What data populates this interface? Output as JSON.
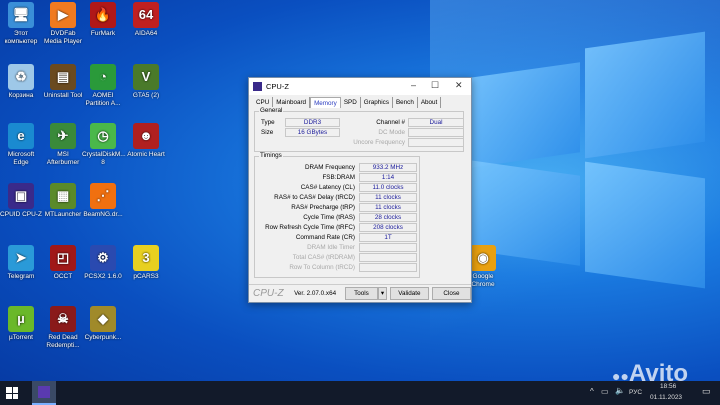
{
  "desktop_icons": [
    {
      "label": "Этот компьютер",
      "glyph": "🖥",
      "color": "#3a8fd8"
    },
    {
      "label": "DVDFab Media Player",
      "glyph": "▶",
      "color": "#f07a20"
    },
    {
      "label": "FurMark",
      "glyph": "🔥",
      "color": "#b01818"
    },
    {
      "label": "AIDA64",
      "glyph": "64",
      "color": "#c02020"
    },
    {
      "label": "Корзина",
      "glyph": "♻",
      "color": "#9ec8e8"
    },
    {
      "label": "Uninstall Tool",
      "glyph": "▤",
      "color": "#6a4a20"
    },
    {
      "label": "AOMEI Partition A...",
      "glyph": "◔",
      "color": "#2a9a3a"
    },
    {
      "label": "GTA5 (2)",
      "glyph": "V",
      "color": "#4a7a2a"
    },
    {
      "label": "Microsoft Edge",
      "glyph": "e",
      "color": "#1a8ad0"
    },
    {
      "label": "MSI Afterburner",
      "glyph": "✈",
      "color": "#3a8a3a"
    },
    {
      "label": "CrystalDiskM... 8",
      "glyph": "◷",
      "color": "#4ab84a"
    },
    {
      "label": "Atomic Heart",
      "glyph": "☻",
      "color": "#b02020"
    },
    {
      "label": "CPUID CPU-Z",
      "glyph": "▣",
      "color": "#3a2a8a"
    },
    {
      "label": "MTLauncher",
      "glyph": "▦",
      "color": "#5a8a2a"
    },
    {
      "label": "BeamNG.dr...",
      "glyph": "⋰",
      "color": "#f07010"
    },
    {
      "label": "Telegram",
      "glyph": "➤",
      "color": "#2a9ad8"
    },
    {
      "label": "OCCT",
      "glyph": "◰",
      "color": "#a01818"
    },
    {
      "label": "PCSX2 1.6.0",
      "glyph": "⚙",
      "color": "#2a4ab0"
    },
    {
      "label": "pCARS3",
      "glyph": "3",
      "color": "#e8d020"
    },
    {
      "label": "µTorrent",
      "glyph": "µ",
      "color": "#6ab82a"
    },
    {
      "label": "Red Dead Redempti...",
      "glyph": "☠",
      "color": "#8a1a1a"
    },
    {
      "label": "Cyberpunk...",
      "glyph": "◆",
      "color": "#a08a2a"
    },
    {
      "label": "Google Chrome",
      "glyph": "◉",
      "color": "#e8a010"
    }
  ],
  "cpuz": {
    "title": "CPU-Z",
    "tabs": [
      "CPU",
      "Mainboard",
      "Memory",
      "SPD",
      "Graphics",
      "Bench",
      "About"
    ],
    "general_label": "General",
    "type_label": "Type",
    "type": "DDR3",
    "size_label": "Size",
    "size": "16 GBytes",
    "channel_label": "Channel #",
    "channel": "Dual",
    "dc_mode_label": "DC Mode",
    "uncore_label": "Uncore Frequency",
    "timings_label": "Timings",
    "timings": [
      {
        "label": "DRAM Frequency",
        "value": "933.2 MHz"
      },
      {
        "label": "FSB:DRAM",
        "value": "1:14"
      },
      {
        "label": "CAS# Latency (CL)",
        "value": "11.0 clocks"
      },
      {
        "label": "RAS# to CAS# Delay (tRCD)",
        "value": "11 clocks"
      },
      {
        "label": "RAS# Precharge (tRP)",
        "value": "11 clocks"
      },
      {
        "label": "Cycle Time (tRAS)",
        "value": "28 clocks"
      },
      {
        "label": "Row Refresh Cycle Time (tRFC)",
        "value": "208 clocks"
      },
      {
        "label": "Command Rate (CR)",
        "value": "1T"
      },
      {
        "label": "DRAM Idle Timer",
        "value": ""
      },
      {
        "label": "Total CAS# (tRDRAM)",
        "value": ""
      },
      {
        "label": "Row To Column (tRCD)",
        "value": ""
      }
    ],
    "brand": "CPU-Z",
    "version": "Ver. 2.07.0.x64",
    "tools": "Tools",
    "validate": "Validate",
    "close": "Close"
  },
  "taskbar": {
    "lang": "РУС",
    "time": "18:56",
    "date": "01.11.2023"
  },
  "watermark": "Avito"
}
